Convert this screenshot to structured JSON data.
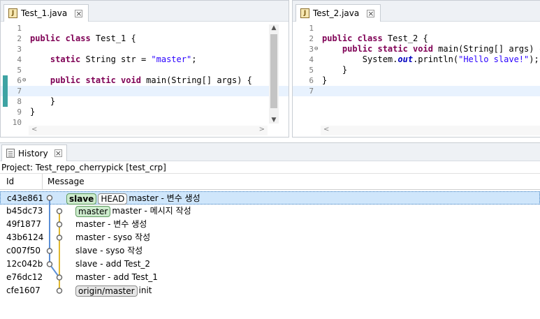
{
  "left_editor": {
    "tab_label": "Test_1.java",
    "lines": [
      {
        "n": "1",
        "t": ""
      },
      {
        "n": "2",
        "kw": "public class ",
        "rest": "Test_1 {"
      },
      {
        "n": "3",
        "t": ""
      },
      {
        "n": "4",
        "kw": "    static ",
        "rest": "String str = ",
        "str": "\"master\"",
        "tail": ";"
      },
      {
        "n": "5",
        "t": ""
      },
      {
        "n": "6",
        "kw": "    public static void ",
        "rest": "main(String[] args) {"
      },
      {
        "n": "7",
        "t": ""
      },
      {
        "n": "8",
        "t": "    }"
      },
      {
        "n": "9",
        "t": "}"
      },
      {
        "n": "10",
        "t": ""
      }
    ]
  },
  "right_editor": {
    "tab_label": "Test_2.java",
    "lines": [
      {
        "n": "1",
        "t": ""
      },
      {
        "n": "2",
        "kw": "public class ",
        "rest": "Test_2 {"
      },
      {
        "n": "3",
        "kw": "    public static void ",
        "rest": "main(String[] args) {"
      },
      {
        "n": "4",
        "pre": "        System.",
        "it": "out",
        "rest": ".println(",
        "str": "\"Hello slave!\"",
        "tail": ");"
      },
      {
        "n": "5",
        "t": "    }"
      },
      {
        "n": "6",
        "t": "}"
      },
      {
        "n": "7",
        "t": ""
      }
    ]
  },
  "history": {
    "tab_label": "History",
    "project_label": "Project: Test_repo_cherrypick [test_crp]",
    "col_id": "Id",
    "col_message": "Message",
    "commits": [
      {
        "id": "c43e861",
        "refs": [
          {
            "label": "slave",
            "style": "green-bold"
          },
          {
            "label": "HEAD",
            "style": "plain"
          }
        ],
        "message": "master - 변수 생성",
        "selected": true
      },
      {
        "id": "b45dc73",
        "refs": [
          {
            "label": "master",
            "style": "green"
          }
        ],
        "message": "master - 메시지 작성"
      },
      {
        "id": "49f1877",
        "refs": [],
        "message": "master - 변수 생성"
      },
      {
        "id": "43b6124",
        "refs": [],
        "message": "master - syso 작성"
      },
      {
        "id": "c007f50",
        "refs": [],
        "message": "slave - syso 작성"
      },
      {
        "id": "12c042b",
        "refs": [],
        "message": "slave - add Test_2"
      },
      {
        "id": "e76dc12",
        "refs": [],
        "message": "master - add Test_1"
      },
      {
        "id": "cfe1607",
        "refs": [
          {
            "label": "origin/master",
            "style": "grey"
          }
        ],
        "message": "init"
      }
    ]
  },
  "colors": {
    "keyword": "#7f0055",
    "string": "#2a00ff",
    "graph_blue": "#5b8fd6",
    "graph_yellow": "#e0b830",
    "selection": "#cfe6fb"
  }
}
